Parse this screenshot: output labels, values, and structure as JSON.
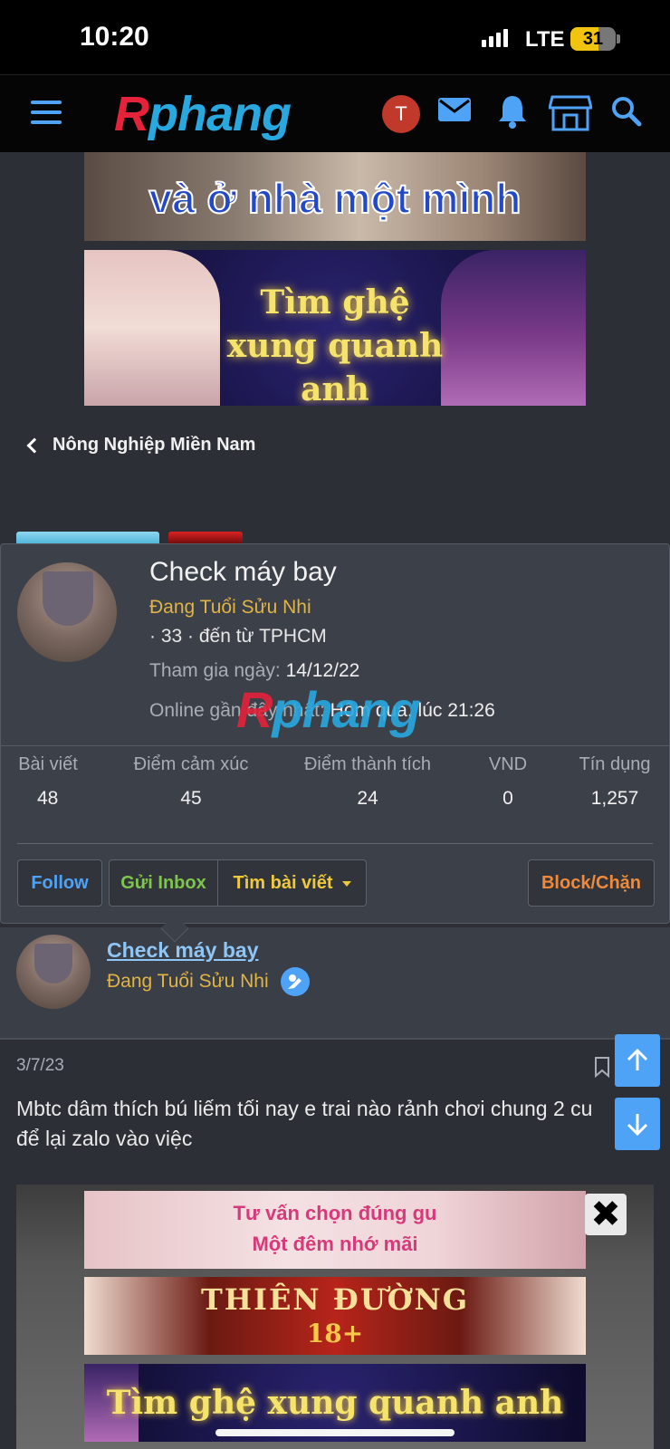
{
  "status_bar": {
    "time": "10:20",
    "network": "LTE",
    "battery": "31"
  },
  "header": {
    "logo_r": "R",
    "logo_rest": "phang",
    "user_initial": "T"
  },
  "banners": {
    "top_text": "và ở nhà một mình",
    "second_line1": "Tìm ghệ",
    "second_line2": "xung quanh anh"
  },
  "breadcrumb": {
    "label": "Nông Nghiệp Miền Nam"
  },
  "profile_card": {
    "name": "Check máy bay",
    "user_title": "Đang Tuổi Sửu Nhi",
    "age_location": "· 33 · đến từ TPHCM",
    "joined_label": "Tham gia ngày:",
    "joined_value": "14/12/22",
    "online_label": "Online gần đây nhất:",
    "online_value": "Hôm qua, lúc 21:26",
    "watermark_r": "R",
    "watermark_rest": "phang",
    "stats": [
      {
        "label": "Bài viết",
        "value": "48"
      },
      {
        "label": "Điểm cảm xúc",
        "value": "45"
      },
      {
        "label": "Điểm thành tích",
        "value": "24"
      },
      {
        "label": "VND",
        "value": "0"
      },
      {
        "label": "Tín dụng",
        "value": "1,257"
      }
    ],
    "buttons": {
      "follow": "Follow",
      "inbox": "Gửi Inbox",
      "find_posts": "Tìm bài viết",
      "block": "Block/Chặn"
    }
  },
  "post": {
    "author_name": "Check máy bay",
    "author_title": "Đang Tuổi Sửu Nhi",
    "date": "3/7/23",
    "text_line1": "Mbtc dâm thích bú liếm tối nay e trai nào rảnh chơi chung 2 cu",
    "text_line2": "để lại zalo vào việc"
  },
  "ads": {
    "ad1_line1": "Tư vấn chọn đúng gu",
    "ad1_line2": "Một đêm nhớ mãi",
    "ad2_line1": "THIÊN ĐƯỜNG",
    "ad2_line2": "18+",
    "ad3_text": "Tìm ghệ xung quanh anh",
    "close": "✖"
  },
  "colors": {
    "accent_blue": "#4fa3f7",
    "title_gold": "#e0b445",
    "inbox_green": "#7ec64b",
    "block_orange": "#f08a3a",
    "logo_red": "#e4223a",
    "logo_blue": "#29a8e0"
  },
  "icons": [
    "hamburger-icon",
    "mail-icon",
    "bell-icon",
    "store-icon",
    "search-icon",
    "chevron-left-icon",
    "verified-badge-icon",
    "bookmark-icon",
    "arrow-up-icon",
    "arrow-down-icon",
    "close-icon"
  ]
}
